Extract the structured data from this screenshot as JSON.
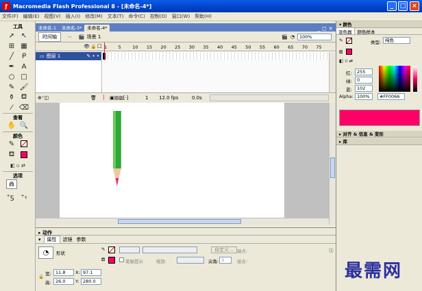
{
  "window": {
    "title": "Macromedia Flash Professional 8 - [未命名-4*]",
    "btn_min": "_",
    "btn_max": "□",
    "btn_close": "×"
  },
  "menu": [
    "文件(F)",
    "编辑(E)",
    "视图(V)",
    "插入(I)",
    "修改(M)",
    "文本(T)",
    "命令(C)",
    "控制(O)",
    "窗口(W)",
    "帮助(H)"
  ],
  "tools": {
    "header": "工具",
    "view_header": "查看",
    "color_header": "颜色",
    "options_header": "选项"
  },
  "doc_tabs": [
    "未命名-1",
    "未命名-3*",
    "未命名-4*"
  ],
  "scene": {
    "timeline_button": "时间轴",
    "scene_label": "场景 1",
    "zoom": "100%"
  },
  "timeline": {
    "frame_numbers": [
      "1",
      "5",
      "10",
      "15",
      "20",
      "25",
      "30",
      "35",
      "40",
      "45",
      "50",
      "55",
      "60",
      "65",
      "70",
      "75"
    ],
    "layer_name": "图层 1",
    "current_frame": "1",
    "fps": "12.0 fps",
    "time": "0.0s"
  },
  "panels": {
    "actions_label": "▸ 动作",
    "property_tabs": [
      "属性",
      "滤镜",
      "参数"
    ],
    "shape_label": "形状",
    "custom_button": "自定义...",
    "stroke_style_label": "端点:",
    "cap_label": "尖角:",
    "cap_value": "3",
    "scale_label": "缩放:",
    "hinting_label": "笔触提示",
    "join_label": "接合:",
    "width_label": "宽:",
    "width_value": "11.8",
    "height_label": "高:",
    "height_value": "26.0",
    "x_label": "X:",
    "x_value": "97.1",
    "y_label": "Y:",
    "y_value": "280.0"
  },
  "color_panel": {
    "header": "▾ 颜色",
    "tab_mixer": "混色器",
    "tab_swatches": "颜色样本",
    "type_label": "类型:",
    "type_value": "纯色",
    "red_label": "红:",
    "red_value": "255",
    "green_label": "绿:",
    "green_value": "0",
    "blue_label": "蓝:",
    "blue_value": "102",
    "alpha_label": "Alpha:",
    "alpha_value": "100%",
    "hex_value": "#FF0066",
    "preview_color": "#FF0066",
    "align_header": "▸ 对齐 & 信息 & 变形",
    "library_header": "▸ 库"
  },
  "watermark": "最需网",
  "colors": {
    "fill": "#ff0066",
    "pencil_green": "#2fa83a",
    "pencil_tip": "#e0307a"
  }
}
